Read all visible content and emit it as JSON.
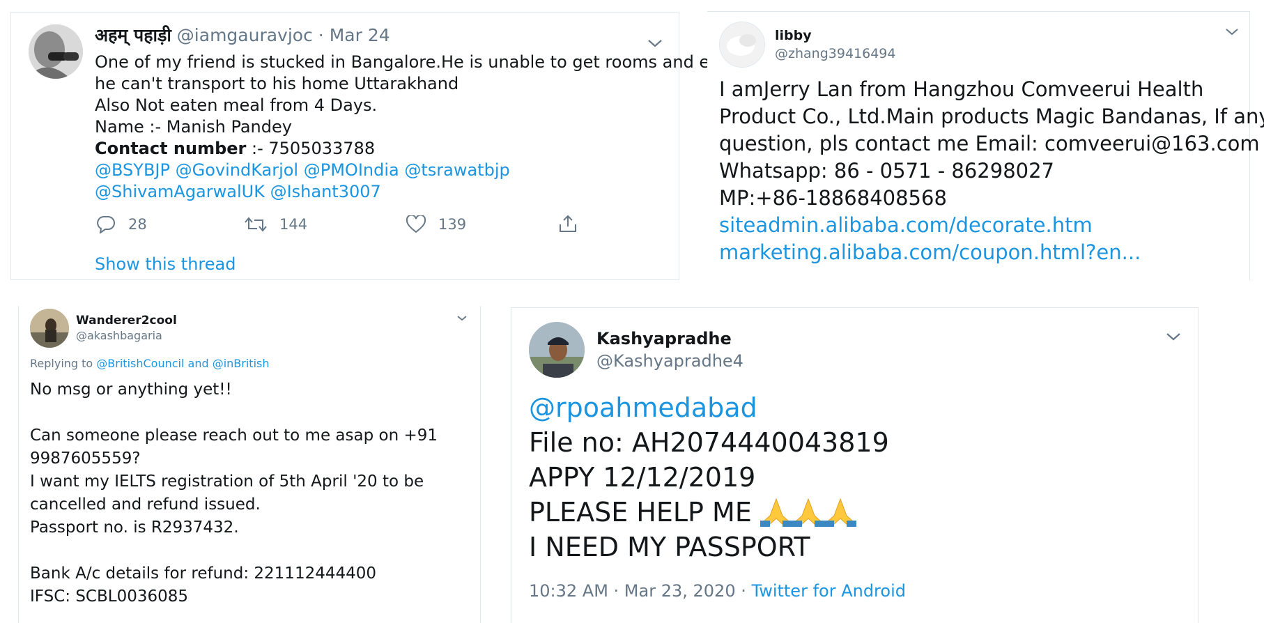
{
  "tweet1": {
    "display_name": "अहम् पहाड़ी",
    "handle": "@iamgauravjoc",
    "separator": "·",
    "date": "Mar 24",
    "lines": [
      "One of my friend is stucked in Bangalore.He is unable to get rooms and even",
      "he can't transport to his home Uttarakhand",
      "Also Not eaten meal from 4 Days.",
      "Name :- Manish Pandey"
    ],
    "contact_label": "Contact number",
    "contact_value": " :- 7505033788",
    "mentions_line1": [
      "@BSYBJP",
      "@GovindKarjol",
      "@PMOIndia",
      "@tsrawatbjp"
    ],
    "mentions_line2": [
      "@ShivamAgarwalUK",
      "@Ishant3007"
    ],
    "reply_count": "28",
    "retweet_count": "144",
    "like_count": "139",
    "show_thread": "Show this thread"
  },
  "tweet2": {
    "display_name": "libby",
    "handle": "@zhang39416494",
    "lines": [
      "I amJerry Lan  from Hangzhou Comveerui Health",
      "Product Co., Ltd.Main products Magic Bandanas,  If any",
      "question, pls contact me Email: comveerui@163.com",
      "Whatsapp: 86 - 0571 - 86298027",
      "MP:+86-18868408568"
    ],
    "links": [
      "siteadmin.alibaba.com/decorate.htm",
      "marketing.alibaba.com/coupon.html?en..."
    ]
  },
  "tweet3": {
    "display_name": "Wanderer2cool",
    "handle": "@akashbagaria",
    "replying_prefix": "Replying to",
    "replying_to_1": "@BritishCouncil",
    "replying_and": "and",
    "replying_to_2": "@inBritish",
    "lines": [
      "No msg or anything yet!!",
      "",
      "Can someone please reach out to me asap on +91",
      "9987605559?",
      "I want my IELTS registration of 5th April '20 to be",
      "cancelled and refund issued.",
      "Passport no. is R2937432.",
      "",
      "Bank A/c details for refund: 221112444400",
      "IFSC: SCBL0036085"
    ]
  },
  "tweet4": {
    "display_name": "Kashyapradhe",
    "handle": "@Kashyapradhe4",
    "mention": "@rpoahmedabad",
    "lines": [
      "File no: AH2074440043819",
      "APPY 12/12/2019",
      "PLEASE HELP ME",
      "I NEED MY PASSPORT"
    ],
    "emoji_count": 3,
    "timestamp": "10:32 AM · Mar 23, 2020 ·",
    "source": "Twitter for Android"
  },
  "colors": {
    "link": "#1b95e0",
    "secondary_text": "#657786",
    "primary_text": "#14171a",
    "border": "#e1e8ed"
  }
}
